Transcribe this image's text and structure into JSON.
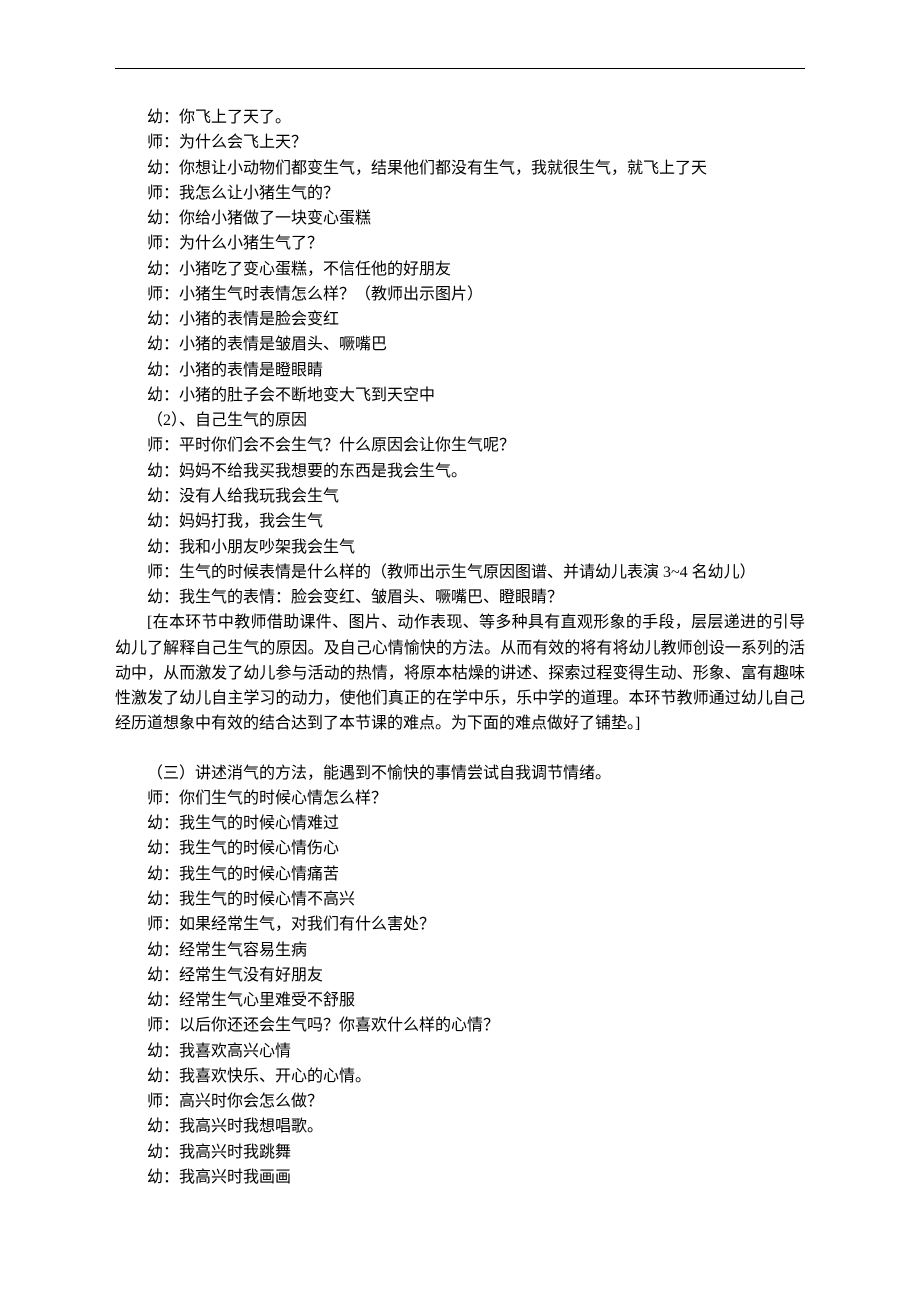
{
  "dialogue_block_1": [
    "幼：你飞上了天了。",
    "师：为什么会飞上天？",
    "幼：你想让小动物们都变生气，结果他们都没有生气，我就很生气，就飞上了天",
    "师：我怎么让小猪生气的？",
    "幼：你给小猪做了一块变心蛋糕",
    "师：为什么小猪生气了？",
    "幼：小猪吃了变心蛋糕，不信任他的好朋友",
    "师：小猪生气时表情怎么样？（教师出示图片）",
    "幼：小猪的表情是脸会变红",
    "幼：小猪的表情是皱眉头、噘嘴巴",
    "幼：小猪的表情是瞪眼睛",
    "幼：小猪的肚子会不断地变大飞到天空中",
    "（2）、自己生气的原因",
    "师：平时你们会不会生气？什么原因会让你生气呢？",
    "幼：妈妈不给我买我想要的东西是我会生气。",
    "幼：没有人给我玩我会生气",
    "幼：妈妈打我，我会生气",
    "幼：我和小朋友吵架我会生气",
    "师：生气的时候表情是什么样的（教师出示生气原因图谱、并请幼儿表演 3~4 名幼儿）",
    "幼：我生气的表情：脸会变红、皱眉头、噘嘴巴、瞪眼睛？"
  ],
  "commentary_paragraph": "[在本环节中教师借助课件、图片、动作表现、等多种具有直观形象的手段，层层递进的引导幼儿了解释自己生气的原因。及自己心情愉快的方法。从而有效的将有将幼儿教师创设一系列的活动中，从而激发了幼儿参与活动的热情，将原本枯燥的讲述、探索过程变得生动、形象、富有趣味性激发了幼儿自主学习的动力，使他们真正的在学中乐，乐中学的道理。本环节教师通过幼儿自己经历道想象中有效的结合达到了本节课的难点。为下面的难点做好了铺垫。]",
  "dialogue_block_2": [
    "（三）讲述消气的方法，能遇到不愉快的事情尝试自我调节情绪。",
    "师：你们生气的时候心情怎么样？",
    "幼：我生气的时候心情难过",
    "幼：我生气的时候心情伤心",
    "幼：我生气的时候心情痛苦",
    "幼：我生气的时候心情不高兴",
    "师：如果经常生气，对我们有什么害处？",
    "幼：经常生气容易生病",
    "幼：经常生气没有好朋友",
    "幼：经常生气心里难受不舒服",
    "师：以后你还还会生气吗？你喜欢什么样的心情？",
    "幼：我喜欢高兴心情",
    "幼：我喜欢快乐、开心的心情。",
    "师：高兴时你会怎么做？",
    "幼：我高兴时我想唱歌。",
    "幼：我高兴时我跳舞",
    "幼：我高兴时我画画"
  ]
}
